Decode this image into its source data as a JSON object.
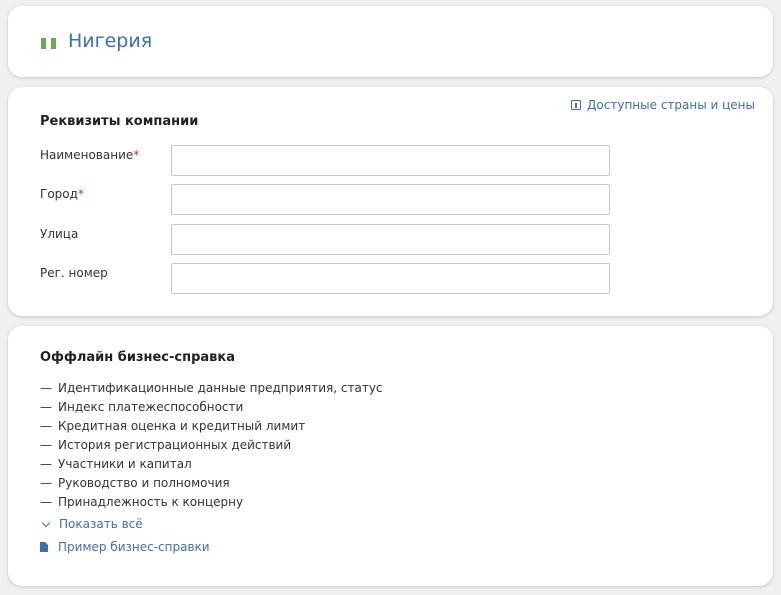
{
  "country": {
    "name": "Нигерия",
    "flag_color": "#6aa84f"
  },
  "company_form": {
    "title": "Реквизиты компании",
    "countries_link": "Доступные страны и цены",
    "fields": [
      {
        "label": "Наименование",
        "required_mark": "*",
        "value": ""
      },
      {
        "label": "Город",
        "required_mark": "*",
        "value": ""
      },
      {
        "label": "Улица",
        "value": ""
      },
      {
        "label": "Рег. номер",
        "value": ""
      }
    ]
  },
  "offline_report": {
    "title": "Оффлайн бизнес-справка",
    "dash": "—",
    "items": [
      "Идентификационные данные предприятия, статус",
      "Индекс платежеспособности",
      "Кредитная оценка и кредитный лимит",
      "История регистрационных действий",
      "Участники и капитал",
      "Руководство и полномочия",
      "Принадлежность к концерну"
    ],
    "show_all": "Показать всё",
    "sample_link": "Пример бизнес-справки"
  },
  "colors": {
    "link": "#3f6fb1",
    "required": "#c0392b"
  }
}
